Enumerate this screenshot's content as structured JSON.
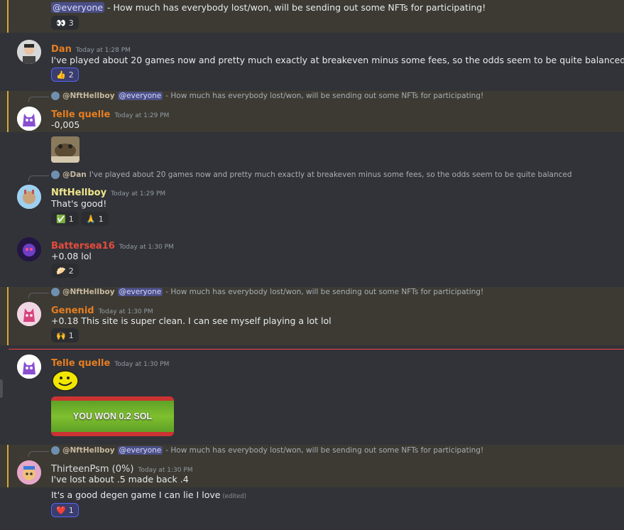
{
  "messages": [
    {
      "text_pre": "",
      "mention": "@everyone",
      "text_post": " - How much has everybody lost/won, will be sending out some NFTs for participating!",
      "reaction": {
        "emoji": "👀",
        "count": "3"
      }
    },
    {
      "author": "Dan",
      "time": "Today at 1:28 PM",
      "text": "I've played about 20 games now and pretty much exactly at breakeven minus some fees, so the odds seem to be quite balanced",
      "reaction": {
        "emoji": "👍",
        "count": "2"
      }
    },
    {
      "reply": {
        "user": "@NftHellboy",
        "mention": "@everyone",
        "text": " - How much has everybody lost/won, will be sending out some NFTs for participating!"
      },
      "author": "Telle quelle",
      "time": "Today at 1:29 PM",
      "text": "-0,005"
    },
    {
      "reply": {
        "user": "@Dan",
        "text": " I've played about 20 games now and pretty much exactly at breakeven minus some fees, so the odds seem to be quite balanced"
      },
      "author": "NftHellboy",
      "time": "Today at 1:29 PM",
      "text": "That's good!",
      "reactions": [
        {
          "emoji": "✅",
          "count": "1"
        },
        {
          "emoji": "🙏",
          "count": "1"
        }
      ]
    },
    {
      "author": "Battersea16",
      "time": "Today at 1:30 PM",
      "text": "+0.08 lol",
      "reaction": {
        "emoji": "🥟",
        "count": "2"
      }
    },
    {
      "reply": {
        "user": "@NftHellboy",
        "mention": "@everyone",
        "text": " - How much has everybody lost/won, will be sending out some NFTs for participating!"
      },
      "author": "Genenid",
      "time": "Today at 1:30 PM",
      "text": "+0.18 This site is super clean. I can see myself playing a lot lol",
      "reaction": {
        "emoji": "🙌",
        "count": "1"
      }
    },
    {
      "author": "Telle quelle",
      "time": "Today at 1:30 PM",
      "image_text": "YOU WON 0.2 SOL"
    },
    {
      "reply": {
        "user": "@NftHellboy",
        "mention": "@everyone",
        "text": " - How much has everybody lost/won, will be sending out some NFTs for participating!"
      },
      "author": "ThirteenPsm (0%)",
      "time": "Today at 1:30 PM",
      "text": "I've lost about .5 made back .4",
      "text2": "It's a good degen game I can lie I love",
      "edited": "(edited)",
      "reaction": {
        "emoji": "❤️",
        "count": "1"
      }
    }
  ],
  "colors": {
    "orange": "#e67e22",
    "yellow": "#f0e68c",
    "red": "#e74c3c",
    "dan": "#e67e22"
  }
}
